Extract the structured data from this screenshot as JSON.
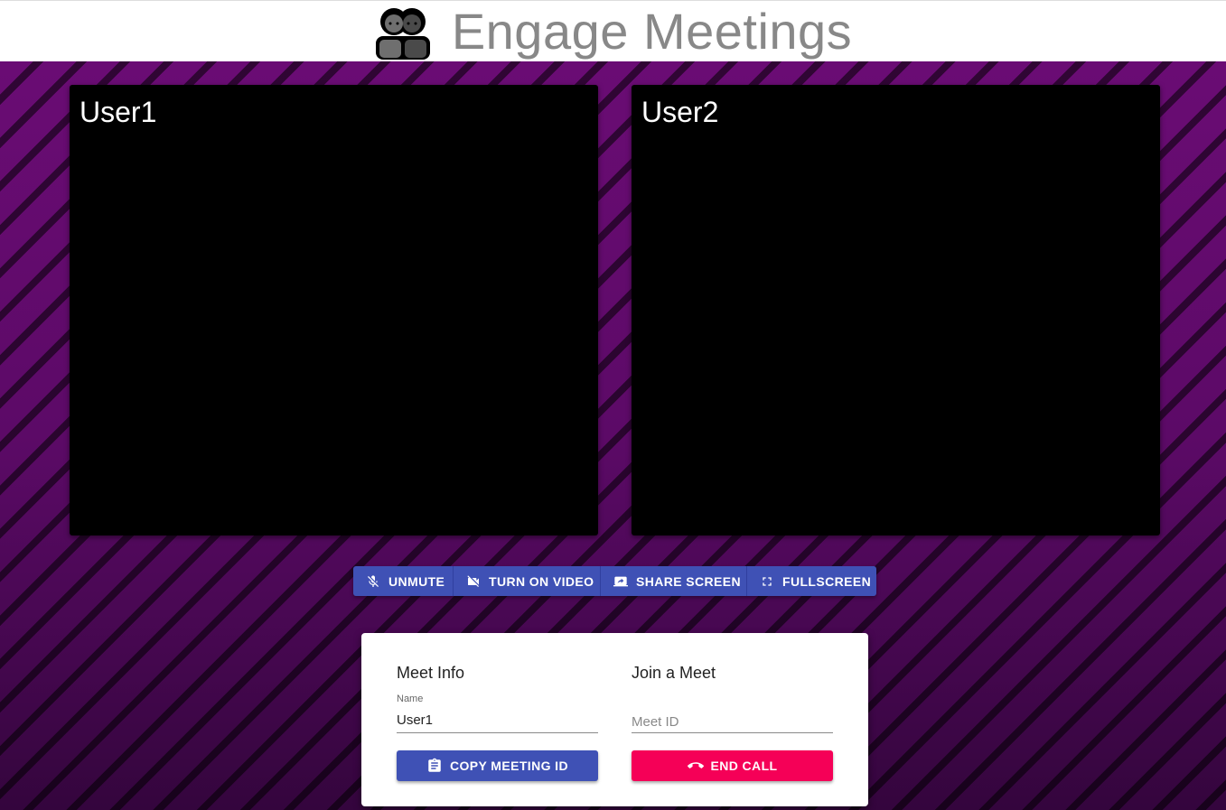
{
  "header": {
    "title": "Engage Meetings",
    "logo_icon": "two-people-icon"
  },
  "videos": [
    {
      "label": "User1"
    },
    {
      "label": "User2"
    }
  ],
  "controls": {
    "unmute_label": "UNMUTE",
    "video_label": "TURN ON VIDEO",
    "share_label": "SHARE SCREEN",
    "fullscreen_label": "FULLSCREEN",
    "color": "#3f51b5"
  },
  "meet_info": {
    "heading": "Meet Info",
    "name_label": "Name",
    "name_value": "User1",
    "copy_button": "COPY MEETING ID"
  },
  "join_meet": {
    "heading": "Join a Meet",
    "meet_id_placeholder": "Meet ID",
    "end_call_button": "END CALL",
    "end_call_color": "#f50057"
  }
}
